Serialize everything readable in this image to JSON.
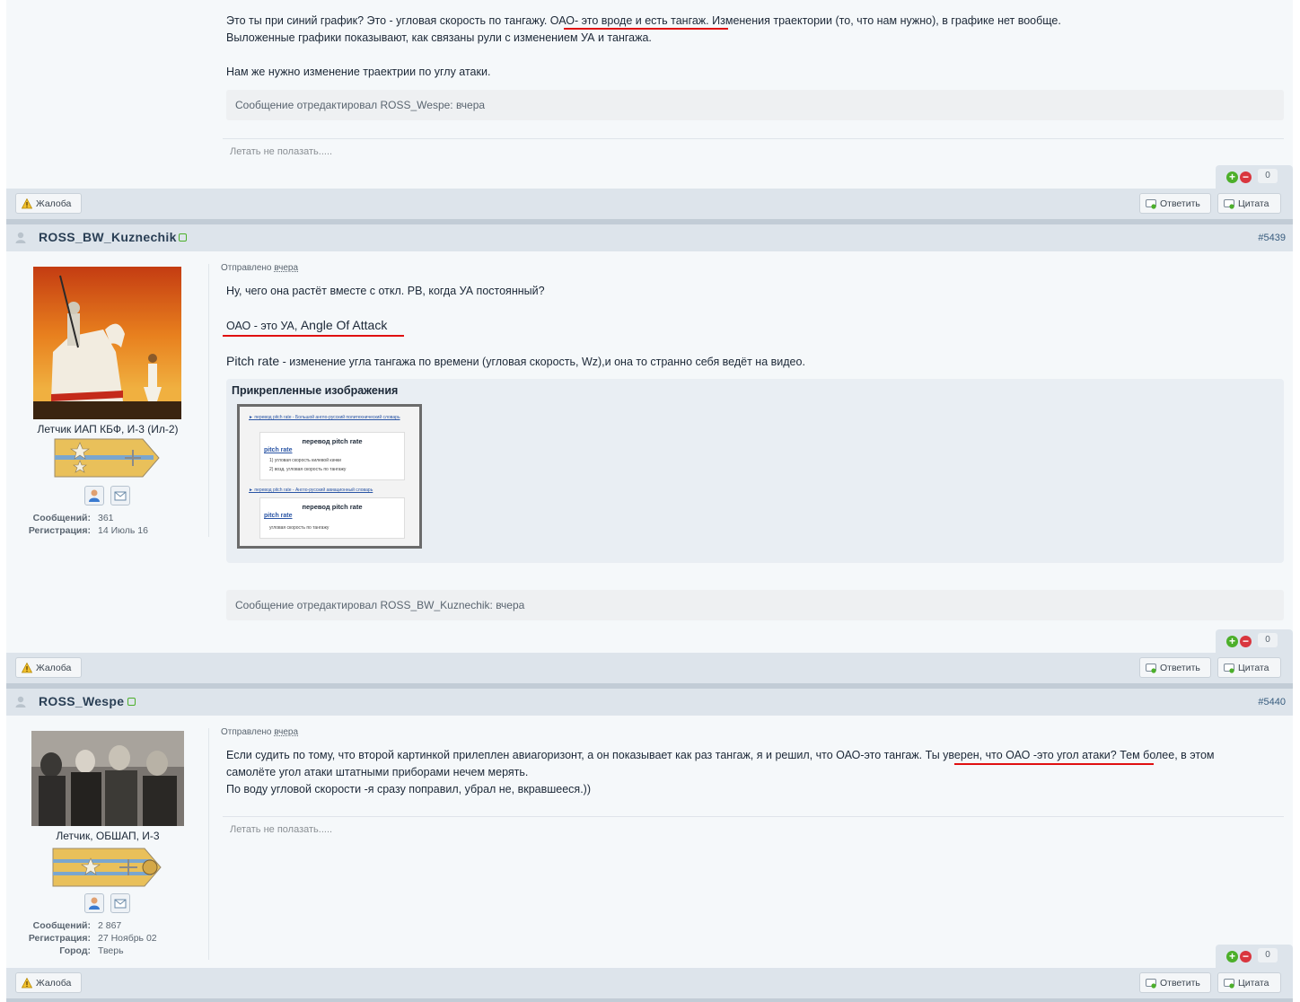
{
  "post1": {
    "lines": [
      {
        "before": "Это ты при синий график? Это - угловая скорость по тангажу. ",
        "highlight": "ОАО- это вроде и есть тангаж.",
        "after": " Изменения траектории (то, что нам нужно), в графике нет вообще."
      },
      {
        "text": "Выложенные графики показывают, как связаны рули с изменением УА и тангажа."
      },
      {
        "text": "Нам же нужно изменение траектрии по углу атаки."
      }
    ],
    "edited": "Сообщение отредактировал ROSS_Wespe: вчера",
    "signature": "Летать не полазать.....",
    "rep_count": "0",
    "report_label": "Жалоба",
    "reply_label": "Ответить",
    "quote_label": "Цитата"
  },
  "post2": {
    "author": "ROSS_BW_Kuznechik",
    "number": "#5439",
    "posted_label": "Отправлено",
    "posted_time": "вчера",
    "rank": "Летчик ИАП КБФ, И-3 (Ил-2)",
    "stats": [
      {
        "label": "Сообщений:",
        "value": "361"
      },
      {
        "label": "Регистрация:",
        "value": "14 Июль 16"
      }
    ],
    "line1": "Ну, чего она растёт вместе с откл. РВ, когда УА постоянный?",
    "line2_a": "ОАО - это УА, ",
    "line2_b": "Angle Of Attack",
    "line3_a": "Pitch rate",
    "line3_b": " - изменение угла тангажа по времени (угловая скорость, Wz),и она то странно себя ведёт на видео.",
    "attach_title": "Прикрепленные изображения",
    "thumb": {
      "link1": "► перевод pitch rate - Большой англо-русский политехнический словарь",
      "head1": "перевод pitch rate",
      "term1": "pitch rate",
      "item1": "1) угловая скорость килевой качки",
      "item2": "2) возд. угловая скорость по тангажу",
      "link2": "► перевод pitch rate - Англо-русский авиационный словарь",
      "head2": "перевод pitch rate",
      "term2": "pitch rate",
      "item3": "угловая скорость по тангажу"
    },
    "edited": "Сообщение отредактировал ROSS_BW_Kuznechik: вчера",
    "rep_count": "0",
    "report_label": "Жалоба",
    "reply_label": "Ответить",
    "quote_label": "Цитата"
  },
  "post3": {
    "author": "ROSS_Wespe",
    "number": "#5440",
    "posted_label": "Отправлено",
    "posted_time": "вчера",
    "rank": "Летчик, ОБШАП, И-3",
    "stats": [
      {
        "label": "Сообщений:",
        "value": "2 867"
      },
      {
        "label": "Регистрация:",
        "value": "27 Ноябрь 02"
      },
      {
        "label": "Город:",
        "value": "Тверь"
      }
    ],
    "line1_a": "Если судить по тому, что второй картинкой прилеплен авиагоризонт, а он показывает как раз тангаж, я и решил, что ОАО-это тангаж. ",
    "line1_b": "Ты уверен, что ОАО -это угол атаки?",
    "line1_c": " Тем более, в этом",
    "line2": "самолёте угол атаки штатными приборами нечем мерять.",
    "line3": "По воду угловой скорости -я сразу поправил, убрал не, вкравшееся.))",
    "signature": "Летать не полазать.....",
    "rep_count": "0",
    "report_label": "Жалоба",
    "reply_label": "Ответить",
    "quote_label": "Цитата"
  },
  "colors": {
    "accent": "#385c7e",
    "highlight": "#e01010",
    "bar": "#dde4eb",
    "post_bg": "#f5f8fa"
  },
  "icons": [
    "warning-icon",
    "reply-icon",
    "quote-icon",
    "user-icon",
    "online-icon",
    "reputation-plus-icon",
    "reputation-minus-icon",
    "profile-icon",
    "message-icon"
  ]
}
